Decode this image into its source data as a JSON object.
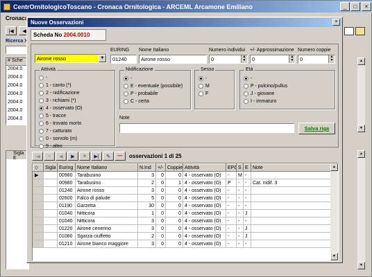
{
  "main_window": {
    "title": "CentrOrnitologicoToscano - Cronaca Ornitologica - ARCEML Arcamone Emiliano",
    "tab": "Cronaca",
    "search_label": "Ricerca X",
    "col1": "# Sche",
    "col2": "Sigla E",
    "rows": [
      "2004.0",
      "2004.0",
      "2004.0",
      "2004.0",
      "2004.0",
      "2004.0",
      "2004.0"
    ]
  },
  "dialog": {
    "title": "Nuove Osservazioni",
    "scheda_label": "Scheda No",
    "scheda_no": "2004.0010",
    "species_select": "Airone rosso",
    "euring_label": "EURING",
    "euring": "01240",
    "nome_label": "Nome Italiano",
    "nome": "Airone rosso",
    "num_label": "Numero individui",
    "num": "0",
    "appr_label": "+/- Approssimazione",
    "appr": "0",
    "coppie_label": "Numero coppie",
    "coppie": "0",
    "attivita_title": "Attività",
    "attivita": [
      "-",
      "1 - canto (*)",
      "2 - nidificazione",
      "3 - richiami (*)",
      "4 - osservato (O)",
      "5 - tracce",
      "6 - trovato morto",
      "7 - catturato",
      "0 - sorvolo (m)",
      "9 - altro"
    ],
    "attivita_sel": 4,
    "nidif_title": "Nidificazione",
    "nidif": [
      "-",
      "E - eventuale (possibile)",
      "P - probabile",
      "C - certa"
    ],
    "sesso_title": "Sesso",
    "sesso": [
      "-",
      "M",
      "F"
    ],
    "eta_title": "Età",
    "eta": [
      "-",
      "P - pulcino/pullus",
      "J - giovane",
      "I - immaturo"
    ],
    "note_label": "Note",
    "note": "",
    "save_label": "Salva riga",
    "nav_text": "osservazioni 1 di 25",
    "columns": [
      "Sigla",
      "Euring",
      "Nome Italiano",
      "N.Ind",
      "+/-",
      "Coppie",
      "Attività",
      "EPC",
      "S",
      "E",
      "Note"
    ],
    "rows": [
      [
        "",
        "00980",
        "Tarabusino",
        "3",
        "0",
        "0",
        "4 - osservato (O)",
        "-",
        "M",
        "-",
        ""
      ],
      [
        "",
        "00980",
        "Tarabusino",
        "2",
        "0",
        "1",
        "4 - osservato (O)",
        "P",
        "-",
        "-",
        "Cat. nidif. 3"
      ],
      [
        "",
        "01240",
        "Airone rosso",
        "3",
        "0",
        "0",
        "4 - osservato (O)",
        "-",
        "-",
        "-",
        ""
      ],
      [
        "",
        "02600",
        "Falco di palude",
        "5",
        "0",
        "0",
        "4 - osservato (O)",
        "-",
        "-",
        "-",
        ""
      ],
      [
        "",
        "01190",
        "Garzetta",
        "30",
        "0",
        "0",
        "4 - osservato (O)",
        "-",
        "-",
        "-",
        ""
      ],
      [
        "",
        "01040",
        "Nitticora",
        "1",
        "0",
        "0",
        "4 - osservato (O)",
        "-",
        "-",
        "J",
        ""
      ],
      [
        "",
        "01040",
        "Nitticora",
        "3",
        "0",
        "0",
        "4 - osservato (O)",
        "-",
        "-",
        "-",
        ""
      ],
      [
        "",
        "01220",
        "Airone cenerino",
        "3",
        "0",
        "0",
        "4 - osservato (O)",
        "-",
        "-",
        "J",
        ""
      ],
      [
        "",
        "01080",
        "Sgarza ciuffetto",
        "2",
        "0",
        "0",
        "4 - osservato (O)",
        "-",
        "-",
        "J",
        ""
      ],
      [
        "",
        "01210",
        "Airone bianco maggiore",
        "3",
        "0",
        "0",
        "4 - osservato (O)",
        "-",
        "-",
        "-",
        ""
      ]
    ]
  },
  "colors": {
    "titlebar": "#0a246a",
    "titlebar_end": "#a6caf0",
    "highlight_select": "#ffff00",
    "scheda_no": "#cc0000",
    "save_text": "#008000"
  }
}
